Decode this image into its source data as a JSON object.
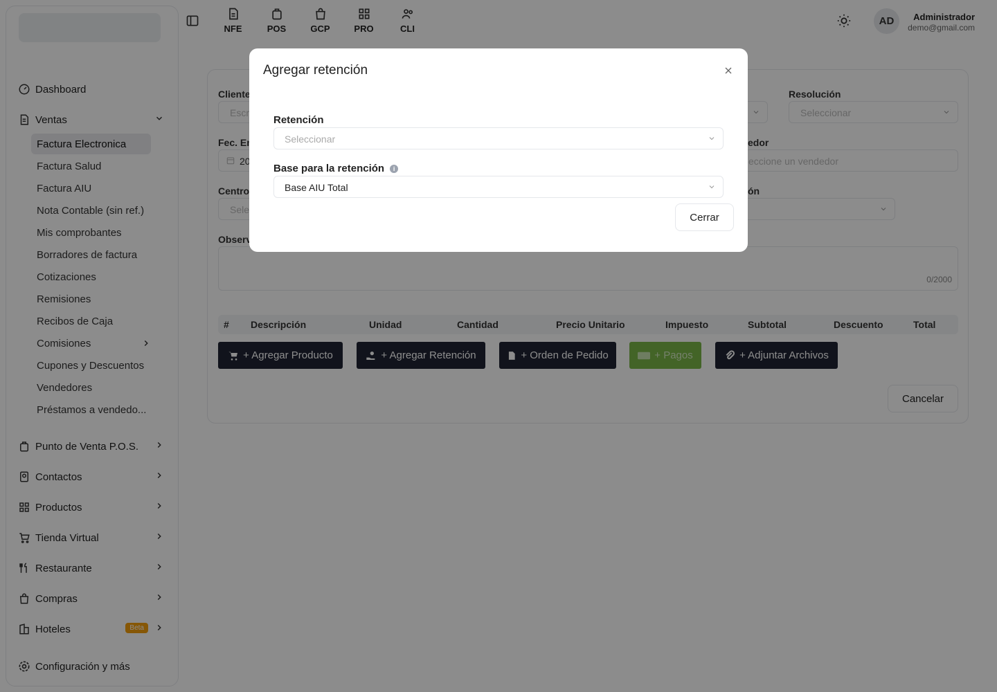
{
  "sidebar": {
    "items": [
      {
        "label": "Dashboard",
        "icon": "gauge-icon"
      },
      {
        "label": "Ventas",
        "icon": "document-icon"
      },
      {
        "label": "Punto de Venta P.O.S.",
        "icon": "pos-icon"
      },
      {
        "label": "Contactos",
        "icon": "contacts-icon"
      },
      {
        "label": "Productos",
        "icon": "grid-icon"
      },
      {
        "label": "Tienda Virtual",
        "icon": "cart-icon"
      },
      {
        "label": "Restaurante",
        "icon": "utensils-icon"
      },
      {
        "label": "Compras",
        "icon": "bag-icon"
      },
      {
        "label": "Hoteles",
        "icon": "building-icon",
        "badge": "Beta"
      },
      {
        "label": "Configuración y más",
        "icon": "gear-icon"
      }
    ],
    "ventas_sub": [
      "Factura Electronica",
      "Factura Salud",
      "Factura AIU",
      "Nota Contable (sin ref.)",
      "Mis comprobantes",
      "Borradores de factura",
      "Cotizaciones",
      "Remisiones",
      "Recibos de Caja",
      "Comisiones",
      "Cupones y Descuentos",
      "Vendedores",
      "Préstamos a vendedo..."
    ]
  },
  "topbar": {
    "apps": [
      "NFE",
      "POS",
      "GCP",
      "PRO",
      "CLI"
    ],
    "user_initials": "AD",
    "user_name": "Administrador",
    "user_email": "demo@gmail.com"
  },
  "form": {
    "cliente_label": "Cliente",
    "cliente_placeholder": "Escri",
    "resolucion_label": "Resolución",
    "resolucion_placeholder": "Seleccionar",
    "fecha_label": "Fec. Em",
    "fecha_value": "20",
    "vendedor_label": "edor",
    "vendedor_placeholder": "eccione un vendedor",
    "centro_label": "Centro",
    "centro_placeholder": "Selec",
    "other_label": "ón",
    "observ_label": "Observ",
    "counter": "0/2000",
    "table_headers": [
      "#",
      "Descripción",
      "Unidad",
      "Cantidad",
      "Precio Unitario",
      "Impuesto",
      "Subtotal",
      "Descuento",
      "Total"
    ],
    "buttons": [
      "+ Agregar Producto",
      "+ Agregar Retención",
      "+ Orden de Pedido",
      "+ Pagos",
      "+ Adjuntar Archivos"
    ],
    "cancel": "Cancelar"
  },
  "modal": {
    "title": "Agregar retención",
    "retencion_label": "Retención",
    "retencion_placeholder": "Seleccionar",
    "base_label": "Base para la retención",
    "base_value": "Base AIU Total",
    "close_button": "Cerrar"
  },
  "colors": {
    "dark_button": "#1f2433",
    "green_button": "#7ab648",
    "badge": "#f59e0b"
  }
}
